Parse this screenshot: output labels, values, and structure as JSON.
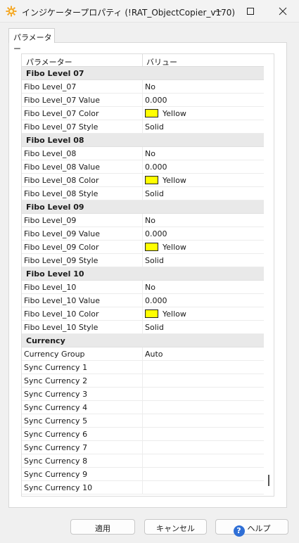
{
  "window": {
    "title": "インジケータープロパティ (!RAT_ObjectCopier_v170)",
    "icon": "gear-sun-icon"
  },
  "tabs": [
    {
      "label": "パラメーター",
      "active": true
    }
  ],
  "grid": {
    "headers": {
      "name": "パラメーター",
      "value": "バリュー"
    },
    "rows": [
      {
        "type": "group",
        "name": "Fibo Level 07"
      },
      {
        "type": "param",
        "name": "Fibo Level_07",
        "value": "No"
      },
      {
        "type": "param",
        "name": "Fibo Level_07 Value",
        "value": "0.000"
      },
      {
        "type": "color",
        "name": "Fibo Level_07 Color",
        "value": "Yellow",
        "color": "#ffff00"
      },
      {
        "type": "param",
        "name": "Fibo Level_07 Style",
        "value": "Solid"
      },
      {
        "type": "group",
        "name": "Fibo Level 08"
      },
      {
        "type": "param",
        "name": "Fibo Level_08",
        "value": "No"
      },
      {
        "type": "param",
        "name": "Fibo Level_08 Value",
        "value": "0.000"
      },
      {
        "type": "color",
        "name": "Fibo Level_08 Color",
        "value": "Yellow",
        "color": "#ffff00"
      },
      {
        "type": "param",
        "name": "Fibo Level_08 Style",
        "value": "Solid"
      },
      {
        "type": "group",
        "name": "Fibo Level 09"
      },
      {
        "type": "param",
        "name": "Fibo Level_09",
        "value": "No"
      },
      {
        "type": "param",
        "name": "Fibo Level_09 Value",
        "value": "0.000"
      },
      {
        "type": "color",
        "name": "Fibo Level_09 Color",
        "value": "Yellow",
        "color": "#ffff00"
      },
      {
        "type": "param",
        "name": "Fibo Level_09 Style",
        "value": "Solid"
      },
      {
        "type": "group",
        "name": "Fibo Level 10"
      },
      {
        "type": "param",
        "name": "Fibo Level_10",
        "value": "No"
      },
      {
        "type": "param",
        "name": "Fibo Level_10 Value",
        "value": "0.000"
      },
      {
        "type": "color",
        "name": "Fibo Level_10 Color",
        "value": "Yellow",
        "color": "#ffff00"
      },
      {
        "type": "param",
        "name": "Fibo Level_10 Style",
        "value": "Solid"
      },
      {
        "type": "group",
        "name": "Currency"
      },
      {
        "type": "param",
        "name": "Currency Group",
        "value": "Auto"
      },
      {
        "type": "param",
        "name": "Sync Currency 1",
        "value": ""
      },
      {
        "type": "param",
        "name": "Sync Currency 2",
        "value": ""
      },
      {
        "type": "param",
        "name": "Sync Currency 3",
        "value": ""
      },
      {
        "type": "param",
        "name": "Sync Currency 4",
        "value": ""
      },
      {
        "type": "param",
        "name": "Sync Currency 5",
        "value": ""
      },
      {
        "type": "param",
        "name": "Sync Currency 6",
        "value": ""
      },
      {
        "type": "param",
        "name": "Sync Currency 7",
        "value": ""
      },
      {
        "type": "param",
        "name": "Sync Currency 8",
        "value": ""
      },
      {
        "type": "param",
        "name": "Sync Currency 9",
        "value": ""
      },
      {
        "type": "param",
        "name": "Sync Currency 10",
        "value": ""
      }
    ]
  },
  "buttons": {
    "apply": "適用",
    "cancel": "キャンセル",
    "help": "ヘルプ",
    "help_icon": "?"
  }
}
